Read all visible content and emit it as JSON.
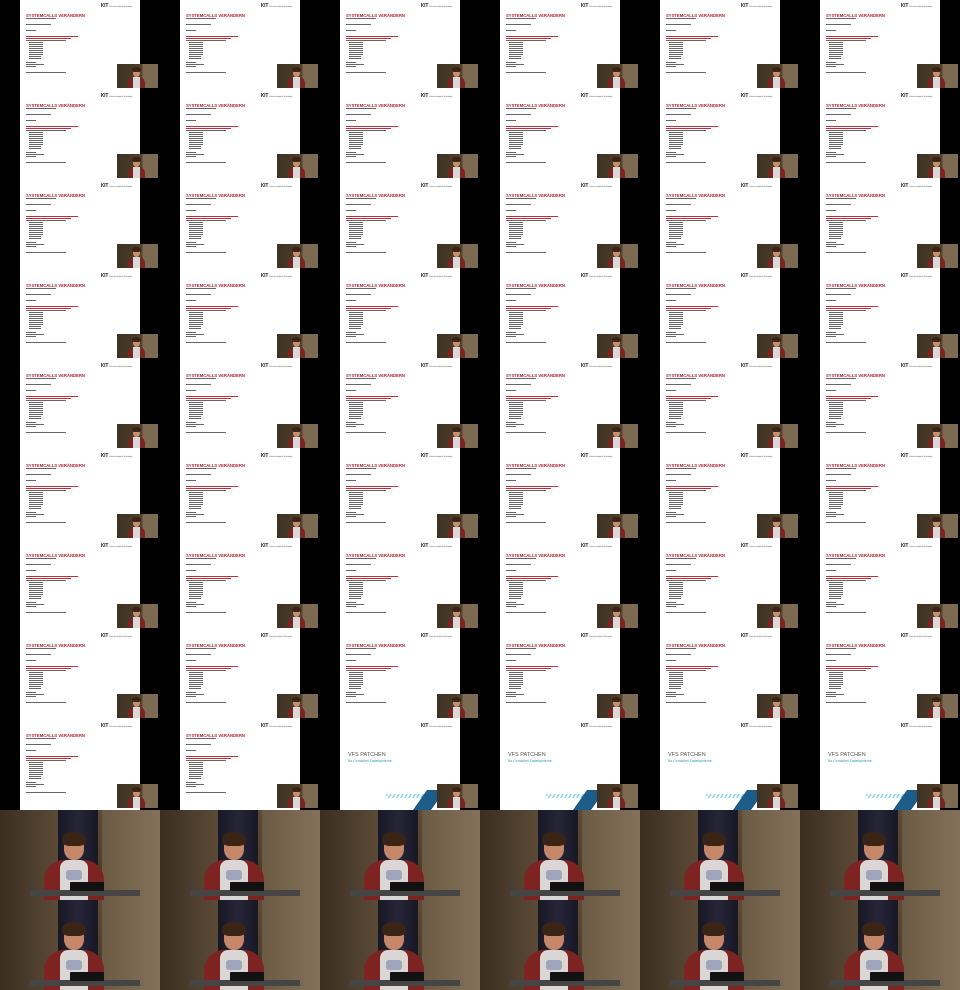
{
  "slide": {
    "title": "SYSTEMCALLS VERÄNDERN",
    "logo": "KIT",
    "logo_sub": "Karlsruher Institut für Technologie"
  },
  "section_slide": {
    "title": "VFS PATCHEN",
    "subtitle": "für Container-Dateisysteme"
  },
  "grid": {
    "columns": 6,
    "slide_rows": 9,
    "camera_rows": 2,
    "section_slide_cells": [
      50,
      51,
      52,
      53
    ]
  },
  "colors": {
    "slide_title": "#b2232f",
    "section_subtitle": "#2a9cb8",
    "section_band": "#1d5b88",
    "background": "#000000"
  },
  "icons": {
    "logo": "kit-logo",
    "speaker": "speaker-video-inset"
  }
}
